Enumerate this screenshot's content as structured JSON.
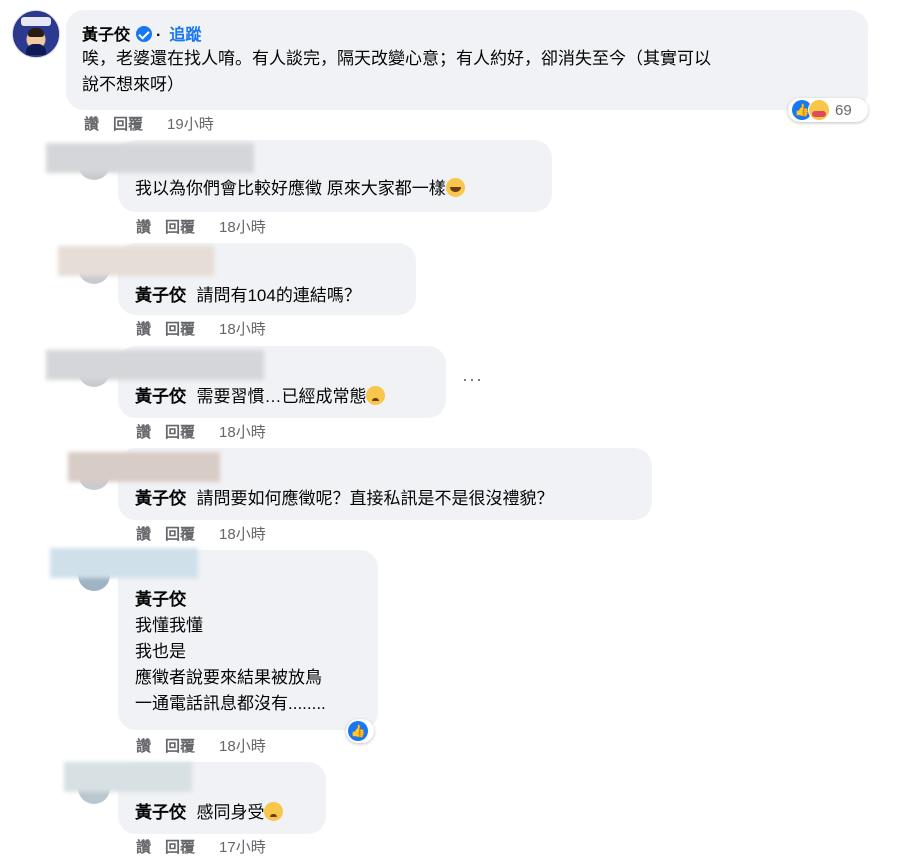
{
  "main_comment": {
    "author": "黃子佼",
    "follow_label": "追蹤",
    "separator": "·",
    "text_line1": "唉，老婆還在找人唷。有人談完，隔天改變心意；有人約好，卻消失至今（其實可以",
    "text_line2": "說不想來呀）",
    "reaction_count": "69",
    "reaction_icons": [
      "like-icon",
      "care-icon"
    ],
    "actions": {
      "like": "讚",
      "reply": "回覆"
    },
    "time": "19小時"
  },
  "replies": [
    {
      "author": "",
      "text": "我以為你們會比較好應徵 原來大家都一樣",
      "emoji": "laugh-cry-emoji",
      "like": "讚",
      "reply": "回覆",
      "time": "18小時"
    },
    {
      "author": "黃子佼",
      "text": "請問有104的連結嗎？",
      "like": "讚",
      "reply": "回覆",
      "time": "18小時"
    },
    {
      "author": "黃子佼",
      "text": "需要習慣…已經成常態",
      "emoji": "sad-emoji",
      "like": "讚",
      "reply": "回覆",
      "time": "18小時"
    },
    {
      "author": "黃子佼",
      "text": "請問要如何應徵呢？直接私訊是不是很沒禮貌？",
      "like": "讚",
      "reply": "回覆",
      "time": "18小時"
    },
    {
      "author": "黃子佼",
      "lines": [
        "我懂我懂",
        "我也是",
        "應徵者說要來結果被放鳥",
        "一通電話訊息都沒有........"
      ],
      "like": "讚",
      "reply": "回覆",
      "time": "18小時"
    },
    {
      "author": "黃子佼",
      "text": "感同身受",
      "emoji": "sad-emoji",
      "like": "讚",
      "reply": "回覆",
      "time": "17小時"
    }
  ],
  "more_options": "···",
  "colors": {
    "bubble": "#f0f2f5",
    "link": "#1877f2",
    "meta": "#65676b"
  }
}
